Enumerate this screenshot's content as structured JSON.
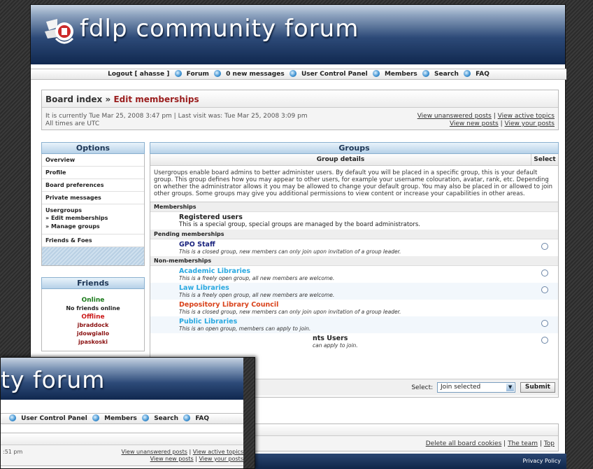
{
  "site": {
    "title": "fdlp community forum",
    "overlay_title": "ty forum"
  },
  "nav": {
    "logout": "Logout [ ahasse ]",
    "forum": "Forum",
    "messages": "0 new messages",
    "ucp": "User Control Panel",
    "members": "Members",
    "search": "Search",
    "faq": "FAQ"
  },
  "breadcrumb": {
    "index": "Board index",
    "sep": "»",
    "current": "Edit memberships"
  },
  "time": {
    "current": "It is currently Tue Mar 25, 2008 3:47 pm | Last visit was: Tue Mar 25, 2008 3:09 pm",
    "tz": "All times are UTC"
  },
  "quicklinks": {
    "unanswered": "View unanswered posts",
    "active": "View active topics",
    "newposts": "View new posts",
    "yourposts": "View your posts",
    "divider": "|"
  },
  "options": {
    "title": "Options",
    "items": [
      {
        "label": "Overview"
      },
      {
        "label": "Profile"
      },
      {
        "label": "Board preferences"
      },
      {
        "label": "Private messages"
      },
      {
        "label": "Usergroups"
      }
    ],
    "sub_items": [
      {
        "label": "» Edit memberships"
      },
      {
        "label": "» Manage groups"
      }
    ],
    "friends_foes": "Friends & Foes"
  },
  "friends": {
    "title": "Friends",
    "online": "Online",
    "none_online": "No friends online",
    "offline": "Offline",
    "offline_members": [
      "jbraddock",
      "jdowgiallo",
      "jpaskoski"
    ]
  },
  "groups": {
    "title": "Groups",
    "col_details": "Group details",
    "col_select": "Select",
    "intro": "Usergroups enable board admins to better administer users. By default you will be placed in a specific group, this is your default group. This group defines how you may appear to other users, for example your username colouration, avatar, rank, etc. Depending on whether the administrator allows it you may be allowed to change your default group. You may also be placed in or allowed to join other groups. Some groups may give you additional permissions to view content or increase your capabilities in other areas.",
    "memberships_label": "Memberships",
    "pending_label": "Pending memberships",
    "non_label": "Non-memberships",
    "memberships": [
      {
        "name": "Registered users",
        "desc": "This is a special group, special groups are managed by the board administrators.",
        "color": "#111111"
      }
    ],
    "pending": [
      {
        "name": "GPO Staff",
        "desc": "This is a closed group, new members can only join upon invitation of a group leader.",
        "color": "#1a237e"
      }
    ],
    "non": [
      {
        "name": "Academic Libraries",
        "desc": "This is a freely open group, all new members are welcome.",
        "color": "#29a8e0"
      },
      {
        "name": "Law Libraries",
        "desc": "This is a freely open group, all new members are welcome.",
        "color": "#29a8e0"
      },
      {
        "name": "Depository Library Council",
        "desc": "This is a closed group, new members can only join upon invitation of a group leader.",
        "color": "#d9421a"
      },
      {
        "name": "Public Libraries",
        "desc": "This is an open group, members can apply to join.",
        "color": "#29a8e0"
      },
      {
        "name": "nts Users",
        "desc": "can apply to join.",
        "color": "#111111"
      }
    ],
    "select_label": "Select:",
    "select_value": "Join selected",
    "submit": "Submit"
  },
  "bottom": {
    "delete_cookies": "Delete all board cookies",
    "team": "The team",
    "top": "Top",
    "divider": "|"
  },
  "footer": {
    "privacy": "Privacy Policy"
  },
  "overlay": {
    "nav_ucp": "User Control Panel",
    "nav_members": "Members",
    "nav_search": "Search",
    "nav_faq": "FAQ",
    "time_fragment": ":51 pm",
    "unanswered": "View unanswered posts",
    "active": "View active topics",
    "newposts": "View new posts",
    "yourposts": "View your posts"
  },
  "colors": {
    "accent": "#9a1d1d",
    "header_dark": "#10284f",
    "online": "#1a7a1a",
    "offline": "#cc1a1a"
  }
}
